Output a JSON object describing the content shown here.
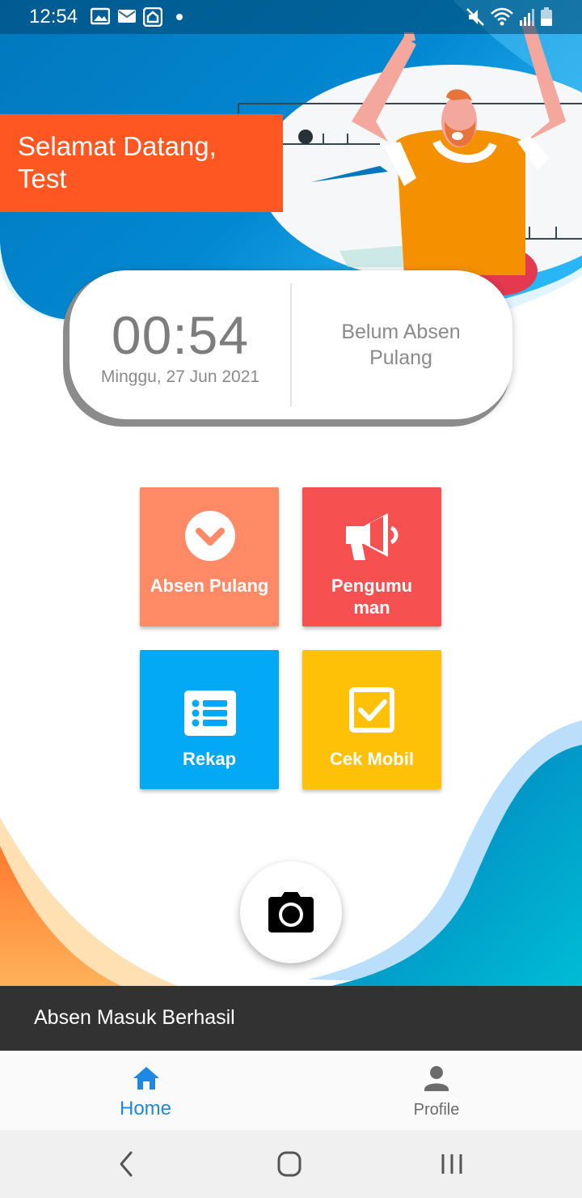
{
  "status_bar": {
    "time": "12:54",
    "icons": [
      "image-icon",
      "mail-icon",
      "home-app-icon",
      "dot-icon",
      "mute-icon",
      "wifi-icon",
      "signal-icon",
      "battery-icon"
    ]
  },
  "header": {
    "welcome": "Selamat Datang, Test"
  },
  "clock_card": {
    "time": "00:54",
    "date": "Minggu, 27 Jun 2021",
    "status": "Belum Absen Pulang"
  },
  "menu": {
    "tiles": [
      {
        "label": "Absen Pulang",
        "icon": "chevron-down-circle-icon",
        "color": "#FF8A65"
      },
      {
        "label": "Pengumuman",
        "display_lines": [
          "Pengumu",
          "man"
        ],
        "icon": "megaphone-icon",
        "color": "#F75050"
      },
      {
        "label": "Rekap",
        "icon": "list-icon",
        "color": "#03A9F4"
      },
      {
        "label": "Cek Mobil",
        "icon": "checkbox-icon",
        "color": "#FFC107"
      }
    ]
  },
  "camera": {
    "icon": "camera-icon"
  },
  "snackbar": {
    "message": "Absen Masuk Berhasil"
  },
  "bottom_nav": {
    "items": [
      {
        "label": "Home",
        "icon": "home-icon",
        "active": true,
        "color": "#1E88E5"
      },
      {
        "label": "Profile",
        "icon": "person-icon",
        "active": false,
        "color": "#6b6b6b"
      }
    ]
  },
  "system_nav": {
    "icons": [
      "back-icon",
      "home-circle-icon",
      "recents-icon"
    ]
  },
  "colors": {
    "accent_orange": "#FF5722",
    "brand_blue": "#0288D1"
  }
}
